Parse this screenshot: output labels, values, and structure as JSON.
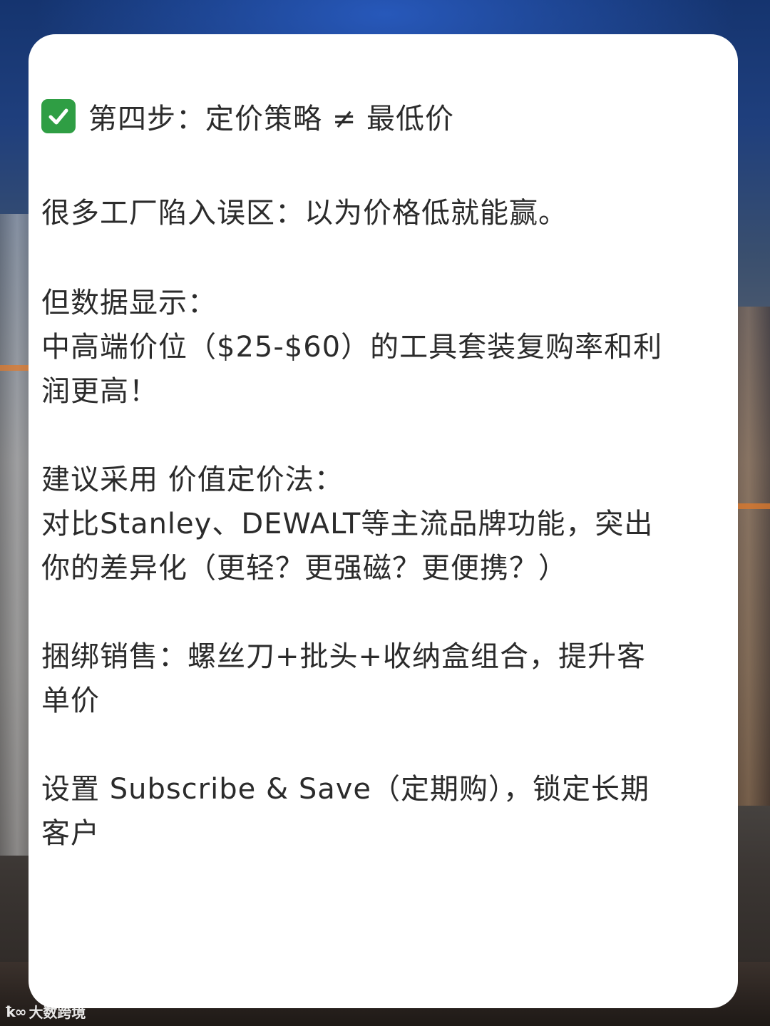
{
  "heading": {
    "icon": "check-mark-icon",
    "text": "第四步：定价策略 ≠ 最低价"
  },
  "paragraphs": {
    "p1": "很多工厂陷入误区：以为价格低就能赢。",
    "p2_line1": "但数据显示：",
    "p2_line2": "中高端价位（$25-$60）的工具套装复购率和利",
    "p2_line3": "润更高！",
    "p3_line1": "建议采用 价值定价法：",
    "p3_line2": "对比Stanley、DEWALT等主流品牌功能，突出",
    "p3_line3": "你的差异化（更轻？更强磁？更便携？）",
    "p4_line1": "捆绑销售：螺丝刀+批头+收纳盒组合，提升客",
    "p4_line2": "单价",
    "p5_line1": "设置 Subscribe & Save（定期购），锁定长期",
    "p5_line2": "客户"
  },
  "watermark": {
    "logo": "ꝁ∞",
    "text": "大数跨境"
  },
  "colors": {
    "text": "#2b2b2b",
    "check_bg": "#2f9e44",
    "card_bg": "#ffffff"
  }
}
